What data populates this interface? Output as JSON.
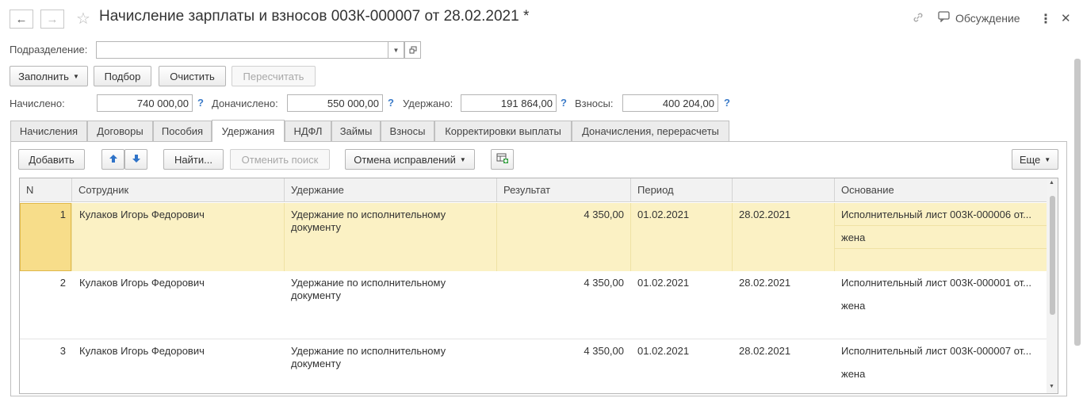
{
  "window": {
    "title": "Начисление зарплаты и взносов 003К-000007 от 28.02.2021 *",
    "discussion_label": "Обсуждение",
    "back_icon": "←",
    "forward_icon": "→",
    "star_icon": "☆",
    "link_icon": "🔗",
    "more_icon": "⋮",
    "close_icon": "✕"
  },
  "department": {
    "label": "Подразделение:",
    "value": ""
  },
  "toolbar": {
    "fill_label": "Заполнить",
    "select_label": "Подбор",
    "clear_label": "Очистить",
    "recalc_label": "Пересчитать"
  },
  "totals": {
    "accrued_label": "Начислено:",
    "accrued_value": "740 000,00",
    "additional_label": "Доначислено:",
    "additional_value": "550 000,00",
    "withheld_label": "Удержано:",
    "withheld_value": "191 864,00",
    "contributions_label": "Взносы:",
    "contributions_value": "400 204,00",
    "help_mark": "?"
  },
  "tabs": [
    "Начисления",
    "Договоры",
    "Пособия",
    "Удержания",
    "НДФЛ",
    "Займы",
    "Взносы",
    "Корректировки выплаты",
    "Доначисления, перерасчеты"
  ],
  "active_tab": "Удержания",
  "table_toolbar": {
    "add_label": "Добавить",
    "find_label": "Найти...",
    "cancel_search_label": "Отменить поиск",
    "undo_corrections_label": "Отмена исправлений",
    "more_label": "Еще"
  },
  "table": {
    "columns": [
      "N",
      "Сотрудник",
      "Удержание",
      "Результат",
      "Период",
      "",
      "Основание"
    ],
    "rows": [
      {
        "n": "1",
        "employee": "Кулаков Игорь Федорович",
        "deduction": "Удержание по исполнительному документу",
        "result": "4 350,00",
        "period_from": "01.02.2021",
        "period_to": "28.02.2021",
        "basis": "Исполнительный лист 003К-000006 от...",
        "basis_note": "жена"
      },
      {
        "n": "2",
        "employee": "Кулаков Игорь Федорович",
        "deduction": "Удержание по исполнительному документу",
        "result": "4 350,00",
        "period_from": "01.02.2021",
        "period_to": "28.02.2021",
        "basis": "Исполнительный лист 003К-000001 от...",
        "basis_note": "жена"
      },
      {
        "n": "3",
        "employee": "Кулаков Игорь Федорович",
        "deduction": "Удержание по исполнительному документу",
        "result": "4 350,00",
        "period_from": "01.02.2021",
        "period_to": "28.02.2021",
        "basis": "Исполнительный лист 003К-000007 от...",
        "basis_note": "жена"
      }
    ]
  },
  "colors": {
    "selected_row": "#fbf1c4",
    "selected_cell": "#f7dd8a",
    "accent_blue": "#3b7bc8"
  }
}
